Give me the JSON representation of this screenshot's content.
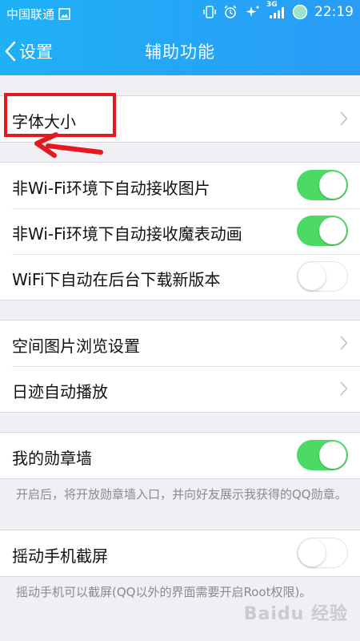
{
  "status_bar": {
    "carrier": "中国联通",
    "network": "3G",
    "time": "22:19"
  },
  "nav": {
    "back_label": "设置",
    "title": "辅助功能"
  },
  "groups": {
    "font": {
      "items": [
        {
          "label": "字体大小"
        }
      ]
    },
    "media": {
      "items": [
        {
          "label": "非Wi-Fi环境下自动接收图片",
          "toggle": "on"
        },
        {
          "label": "非Wi-Fi环境下自动接收魔表动画",
          "toggle": "on"
        },
        {
          "label": "WiFi下自动在后台下载新版本",
          "toggle": "off"
        }
      ]
    },
    "browse": {
      "items": [
        {
          "label": "空间图片浏览设置"
        },
        {
          "label": "日迹自动播放"
        }
      ]
    },
    "medal": {
      "label": "我的勋章墙",
      "toggle": "on",
      "description": "开启后，将开放勋章墙入口，并向好友展示我获得的QQ勋章。"
    },
    "shake": {
      "label": "摇动手机截屏",
      "toggle": "off",
      "description": "摇动手机可以截屏(QQ以外的界面需要开启Root权限)。"
    }
  },
  "watermark": "Baidu 经验",
  "colors": {
    "header": "#2a9cf6",
    "toggle_on": "#4cd964",
    "annotation": "#e5181f"
  }
}
